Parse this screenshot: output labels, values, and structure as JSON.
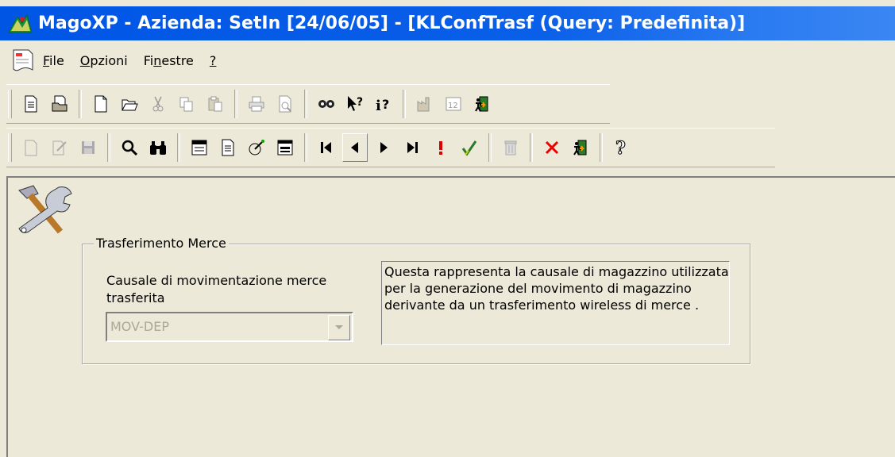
{
  "window": {
    "title": "MagoXP  - Azienda: SetIn [24/06/05] - [KLConfTrasf (Query: Predefinita)]"
  },
  "menu": {
    "items": [
      {
        "pre": "",
        "hot": "F",
        "post": "ile"
      },
      {
        "pre": "",
        "hot": "O",
        "post": "pzioni"
      },
      {
        "pre": "Fi",
        "hot": "n",
        "post": "estre"
      },
      {
        "pre": "",
        "hot": "?",
        "post": ""
      }
    ]
  },
  "toolbar1": {
    "buttons": [
      "new-document-icon",
      "open-document-icon",
      "new-file-icon",
      "open-folder-icon",
      "cut-icon",
      "copy-icon",
      "paste-icon",
      "print-icon",
      "print-preview-icon",
      "camera-icon",
      "context-help-icon",
      "info-help-icon",
      "factory-icon",
      "calendar-icon",
      "exit-icon"
    ]
  },
  "toolbar2": {
    "buttons": [
      "new-record-icon",
      "edit-record-icon",
      "save-icon",
      "search-icon",
      "binoculars-icon",
      "query-icon",
      "report-icon",
      "radar-icon",
      "form-icon",
      "first-record-icon",
      "previous-record-icon",
      "next-record-icon",
      "last-record-icon",
      "alert-icon",
      "check-icon",
      "delete-icon",
      "cancel-icon",
      "exit-icon",
      "help-icon"
    ]
  },
  "group": {
    "title": "Trasferimento Merce",
    "field_label": "Causale di movimentazione merce trasferita",
    "combo_value": "MOV-DEP",
    "description": "Questa rappresenta la causale di magazzino utilizzata per la generazione del movimento di magazzino derivante da un trasferimento wireless di merce ."
  },
  "colors": {
    "titlebar": "#0055e5",
    "face": "#ece9d8"
  }
}
